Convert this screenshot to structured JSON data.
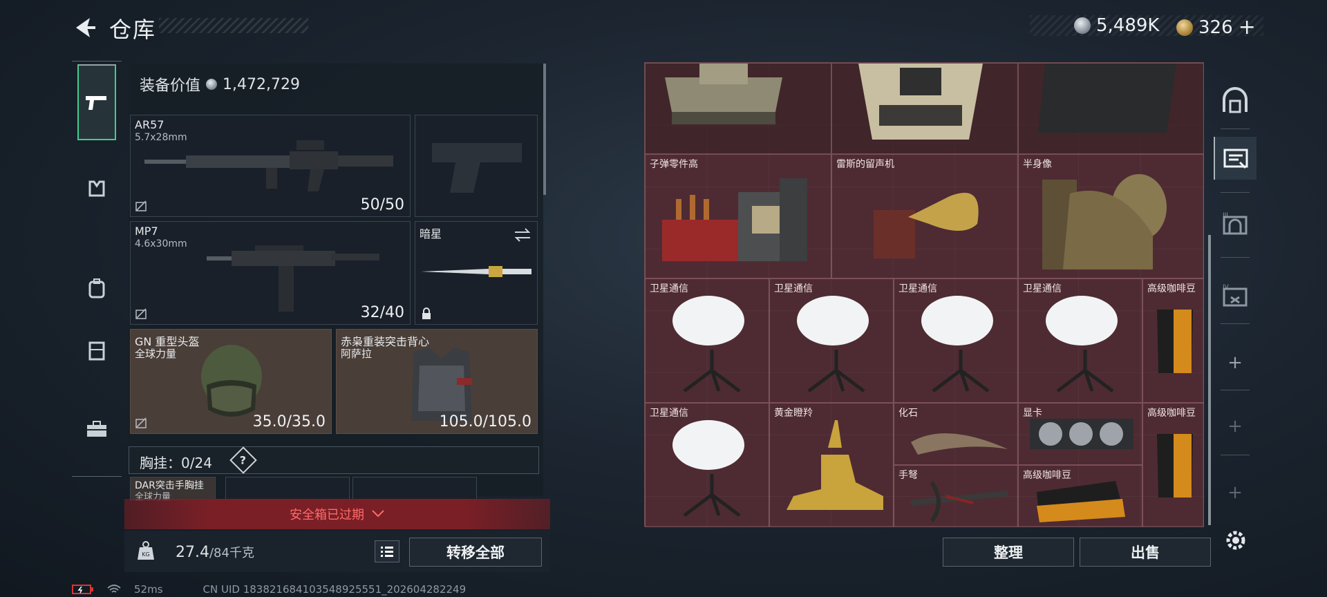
{
  "header": {
    "title": "仓库",
    "currency_silver": "5,489K",
    "currency_gold": "326",
    "currency_add": "+"
  },
  "left_panel": {
    "equipment_value_label": "装备价值",
    "equipment_value": "1,472,729",
    "slots": [
      {
        "name": "AR57",
        "sub": "5.7x28mm",
        "count": "50/50"
      },
      {
        "name": "",
        "sub": "",
        "count": ""
      },
      {
        "name": "MP7",
        "sub": "4.6x30mm",
        "count": "32/40"
      },
      {
        "name": "暗星",
        "sub": "",
        "count": ""
      },
      {
        "name": "GN 重型头盔",
        "sub": "全球力量",
        "count": "35.0/35.0"
      },
      {
        "name": "赤枭重装突击背心",
        "sub": "阿萨拉",
        "count": "105.0/105.0"
      }
    ],
    "chest_rig_label": "胸挂：",
    "chest_rig_value": "0/24",
    "chest_rig_help": "?",
    "chest_item_name": "DAR突击手胸挂",
    "chest_item_sub": "全球力量",
    "safebox_banner": "安全箱已过期",
    "weight": "27.4",
    "weight_max": "/84千克",
    "transfer_all": "转移全部"
  },
  "status": {
    "ping": "52ms",
    "uid": "CN UID 183821684103548925551_202604282249"
  },
  "grid": {
    "items": [
      {
        "label": "子弹零件高"
      },
      {
        "label": "雷斯的留声机"
      },
      {
        "label": "半身像"
      },
      {
        "label": "卫星通信"
      },
      {
        "label": "卫星通信"
      },
      {
        "label": "卫星通信"
      },
      {
        "label": "卫星通信"
      },
      {
        "label": "高级咖啡豆"
      },
      {
        "label": "卫星通信"
      },
      {
        "label": "黄金瞪羚"
      },
      {
        "label": "化石"
      },
      {
        "label": "显卡"
      },
      {
        "label": "高级咖啡豆"
      },
      {
        "label": "手弩"
      },
      {
        "label": "高级咖啡豆"
      }
    ],
    "sort_button": "整理",
    "sell_button": "出售"
  },
  "right_rail": {
    "plus1": "+",
    "plus2": "+",
    "plus3": "+",
    "plus4": "+"
  }
}
